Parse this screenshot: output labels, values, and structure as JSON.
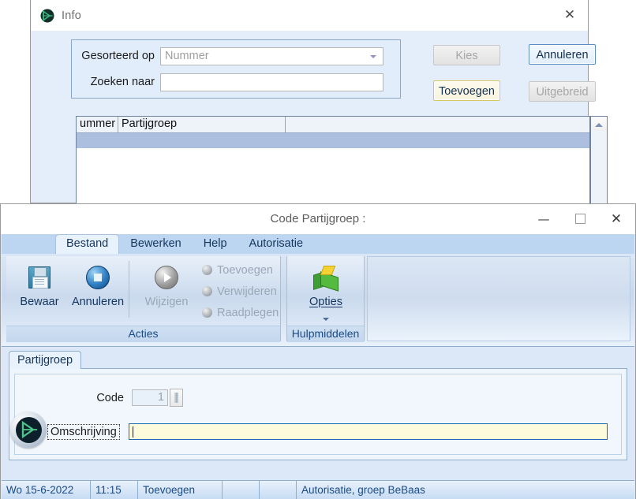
{
  "info_window": {
    "title": "Info",
    "app_icon": "bebaas-logo-icon",
    "close_label": "✕",
    "search_panel": {
      "sort_label": "Gesorteerd op",
      "sort_value": "Nummer",
      "search_label": "Zoeken naar",
      "search_value": ""
    },
    "buttons": {
      "kies": "Kies",
      "annuleren": "Annuleren",
      "toevoegen": "Toevoegen",
      "uitgebreid": "Uitgebreid"
    },
    "list": {
      "columns": [
        "ummer",
        "Partijgroep",
        ""
      ],
      "rows": []
    }
  },
  "main_window": {
    "title": "Code Partijgroep :",
    "app_icon": "bebaas-logo-icon",
    "window_buttons": {
      "minimize": "—",
      "maximize": "maximize-icon",
      "close": "✕"
    },
    "tabs": [
      {
        "label": "Bestand",
        "active": true
      },
      {
        "label": "Bewerken",
        "active": false
      },
      {
        "label": "Help",
        "active": false
      },
      {
        "label": "Autorisatie",
        "active": false
      }
    ],
    "ribbon": {
      "groups": [
        {
          "caption": "Acties",
          "large_buttons": [
            {
              "label": "Bewaar",
              "icon": "save-floppy-icon",
              "disabled": false
            },
            {
              "label": "Annuleren",
              "icon": "cancel-circle-icon",
              "disabled": false
            },
            {
              "label": "Wijzigen",
              "icon": "play-circle-icon",
              "disabled": true
            }
          ],
          "small_buttons": [
            {
              "label": "Toevoegen",
              "icon": "add-icon",
              "disabled": true
            },
            {
              "label": "Verwijderen",
              "icon": "delete-icon",
              "disabled": true
            },
            {
              "label": "Raadplegen",
              "icon": "view-icon",
              "disabled": true
            }
          ]
        },
        {
          "caption": "Hulpmiddelen",
          "large_buttons": [
            {
              "label": "Opties",
              "icon": "green-cube-icon",
              "dropdown": true
            }
          ]
        }
      ]
    },
    "content": {
      "tab_label": "Partijgroep",
      "fields": {
        "code_label": "Code",
        "code_value": "1",
        "code_info_icon": "info-icon",
        "omschrijving_label": "Omschrijving",
        "omschrijving_value": ""
      }
    },
    "statusbar": {
      "date": "Wo  15-6-2022",
      "time": "11:15",
      "mode": "Toevoegen",
      "cell4": "",
      "cell5": "",
      "authorization": "Autorisatie, groep BeBaas"
    }
  },
  "colors": {
    "window_chrome": "#ffffff",
    "ribbon_blue": "#c8d8ed",
    "tabstrip_blue": "#bcd6f2",
    "panel_blue": "#eef5fd",
    "accent_text": "#1a4b85",
    "yellow_field": "#fdfbdc",
    "selection_row": "#adbfdf"
  }
}
